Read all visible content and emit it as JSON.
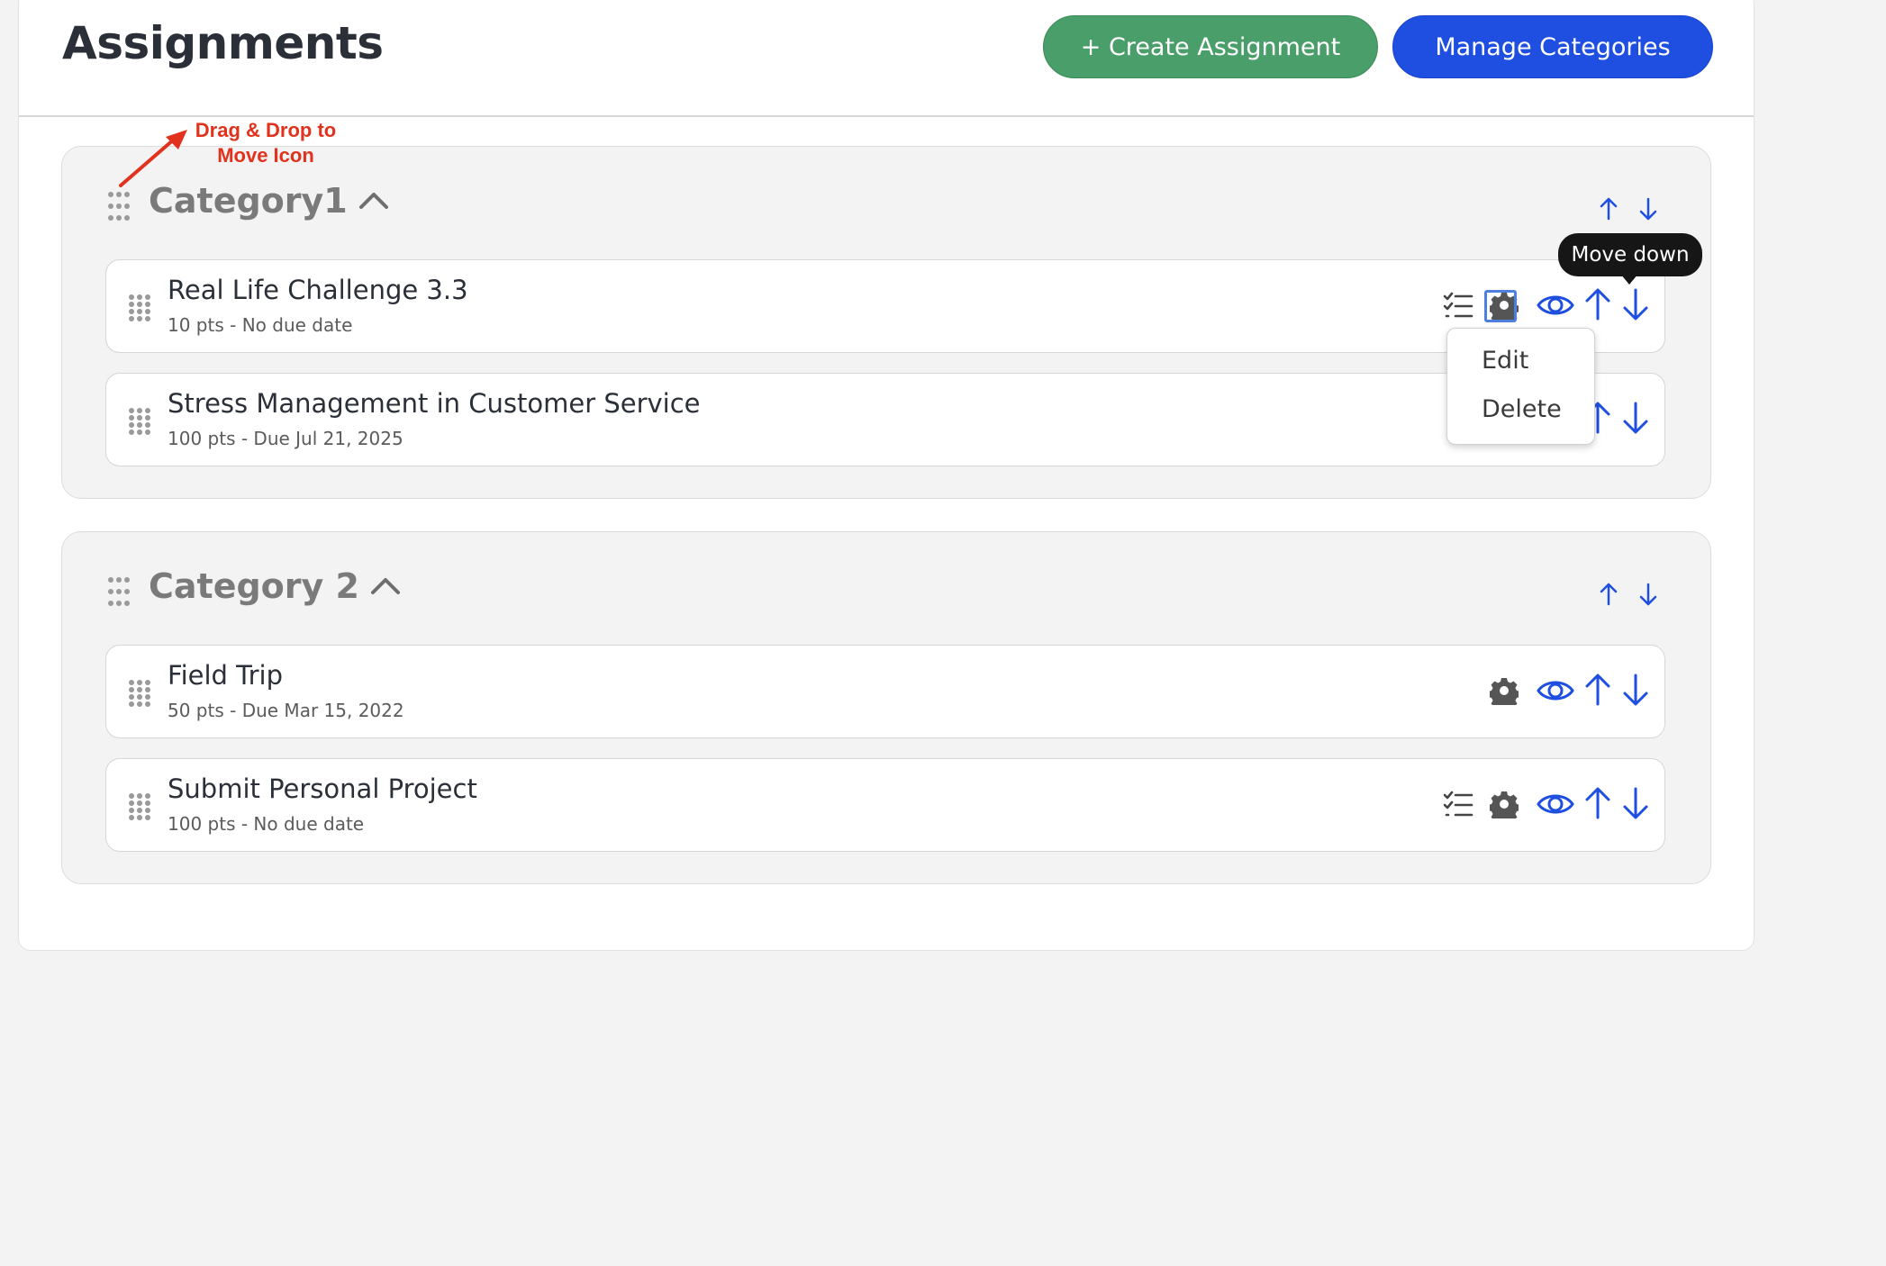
{
  "header": {
    "title": "Assignments",
    "create_label": "+ Create Assignment",
    "manage_label": "Manage Categories"
  },
  "colors": {
    "create_button": "#4a9e6a",
    "manage_button": "#1f4fe0",
    "accent_blue": "#1f4fe0",
    "annotation": "#e0321c"
  },
  "annotation": {
    "line1": "Drag & Drop to",
    "line2": "Move Icon"
  },
  "categories": [
    {
      "name": "Category1",
      "assignments": [
        {
          "title": "Real Life Challenge 3.3",
          "meta": "10 pts - No due date",
          "icons": [
            "checklist-icon",
            "gear-icon",
            "eye-icon",
            "arrow-up-icon",
            "arrow-down-icon"
          ]
        },
        {
          "title": "Stress Management in Customer Service",
          "meta": "100 pts - Due Jul 21, 2025",
          "icons": [
            "checklist-icon",
            "gear-icon",
            "eye-icon",
            "arrow-up-icon",
            "arrow-down-icon"
          ]
        }
      ]
    },
    {
      "name": "Category 2",
      "assignments": [
        {
          "title": "Field Trip",
          "meta": "50 pts - Due Mar 15, 2022",
          "icons": [
            "gear-icon",
            "eye-icon",
            "arrow-up-icon",
            "arrow-down-icon"
          ]
        },
        {
          "title": "Submit Personal Project",
          "meta": "100 pts - No due date",
          "icons": [
            "checklist-icon",
            "gear-icon",
            "eye-icon",
            "arrow-up-icon",
            "arrow-down-icon"
          ]
        }
      ]
    }
  ],
  "context_menu": {
    "edit": "Edit",
    "delete": "Delete"
  },
  "tooltip": "Move down"
}
